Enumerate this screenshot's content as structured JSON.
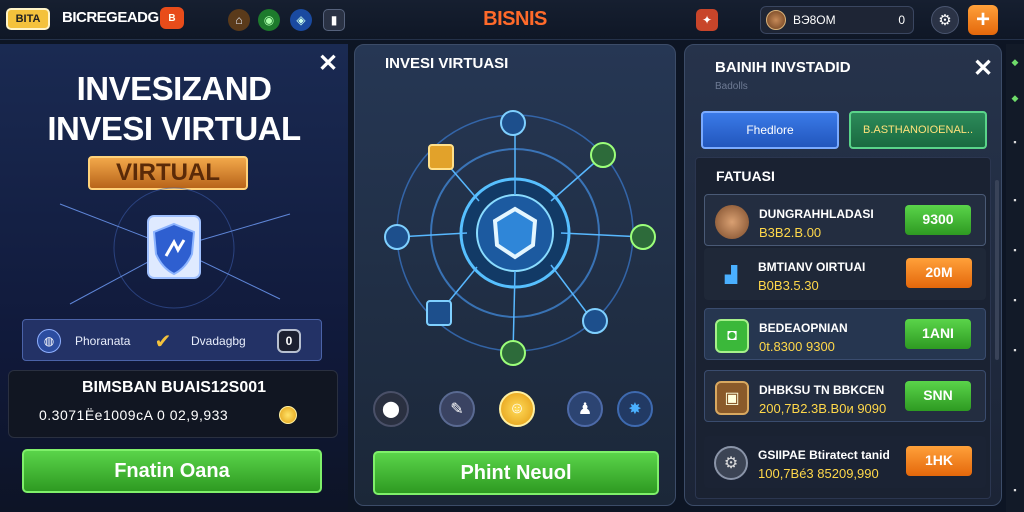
{
  "topbar": {
    "logo_text": "BITA",
    "brand_name": "BICREGEADG",
    "brand_badge": "B",
    "screen_title": "BISNIS",
    "player_name": "BЭ8OM",
    "player_count": "0",
    "settings_icon": "gear-icon",
    "plus_label": "+"
  },
  "left": {
    "close_label": "✕",
    "title_line1": "INVESIZAND",
    "title_line2": "INVESI VIRTUAL",
    "ribbon": "VIRTUAL",
    "strip_item1": "Phoranata",
    "strip_item2": "Dvadagbg",
    "strip_item3_icon": "0",
    "balance_title": "BIMSBAN BUAIS12S001",
    "balance_value": "0.3071Ёe1009сA 0  02,9,933",
    "action_label": "Fnatin Oana"
  },
  "middle": {
    "title": "INVESI VIRTUASI",
    "action_label": "Phint Neuol",
    "icons": [
      "pin-icon",
      "edit-icon",
      "coin-icon",
      "user-icon",
      "star-icon"
    ]
  },
  "right": {
    "close_label": "✕",
    "title": "BAINIH INVSTADID",
    "subtitle": "Badolls",
    "tab1": "Fhedlore",
    "tab2": "B.ASTHANOIOENAL..",
    "features_title": "FATUASI",
    "rows": [
      {
        "name": "DUNGRAHHLADASI",
        "value": "B3B2.B.00",
        "button": "9300",
        "icon": "avatar-icon",
        "color": "#3fb63a"
      },
      {
        "name": "BMTIANV OIRTUAI",
        "value": "B0B3.5.30",
        "button": "20M",
        "icon": "chart-icon",
        "color": "#f28c1a"
      },
      {
        "name": "BEDEAOPNIAN",
        "value": "0t.8300 9300",
        "button": "1ANI",
        "icon": "shield-icon",
        "color": "#3fb63a"
      },
      {
        "name": "DHBKSU TN BBKCEN",
        "value": "200,7B2.3B.B0и 9090",
        "button": "SNN",
        "icon": "chest-icon",
        "color": "#3fb63a"
      },
      {
        "name": "GSIIPAE Btiratect tanid",
        "value": "100,7Bé3 85209,990",
        "button": "1HK",
        "icon": "gear-icon",
        "color": "#f28c1a"
      }
    ]
  },
  "colors": {
    "accent_orange": "#ff6a2a",
    "green_button": "#3fb63a",
    "orange_button": "#f28c1a",
    "gold_text": "#ffd84a"
  }
}
